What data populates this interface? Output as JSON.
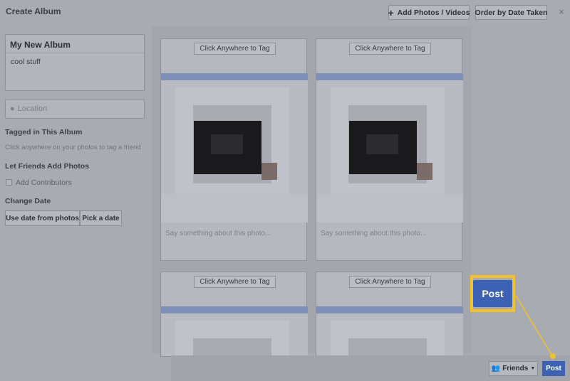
{
  "dialog": {
    "title": "Create Album",
    "close_label": "×",
    "add_photos_label": "Add Photos / Videos",
    "order_label": "Order by Date Taken"
  },
  "sidebar": {
    "album_name": "My New Album",
    "album_description": "cool stuff",
    "location_placeholder": "Location",
    "tagged_heading": "Tagged in This Album",
    "tagged_hint": "Click anywhere on your photos to tag a friend",
    "friends_heading": "Let Friends Add Photos",
    "contributors_label": "Add Contributors",
    "change_date_heading": "Change Date",
    "date_from_photos": "Use date from photos",
    "pick_date": "Pick a date"
  },
  "photos": {
    "tag_label": "Click Anywhere to Tag",
    "caption_placeholder": "Say something about this photo..."
  },
  "footer": {
    "friends_label": "Friends",
    "post_label": "Post",
    "callout_label": "Post"
  },
  "colors": {
    "accent": "#3d62b4",
    "highlight": "#f2c22a"
  }
}
